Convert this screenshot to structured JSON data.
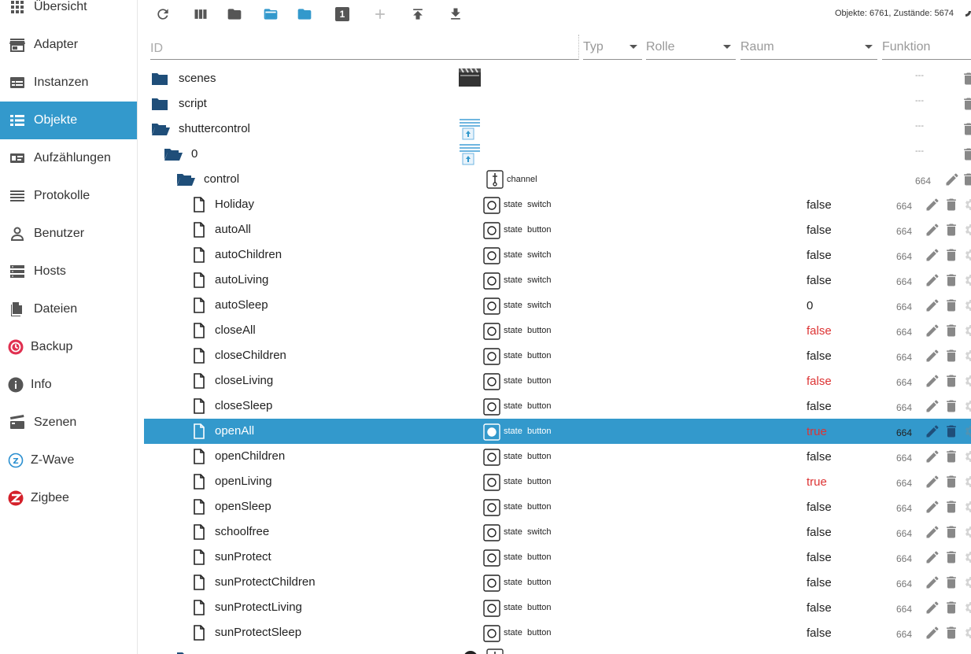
{
  "sidebar": {
    "items": [
      {
        "label": "Übersicht",
        "icon": "grid-icon"
      },
      {
        "label": "Adapter",
        "icon": "store-icon"
      },
      {
        "label": "Instanzen",
        "icon": "instances-icon"
      },
      {
        "label": "Objekte",
        "icon": "list-icon",
        "active": true
      },
      {
        "label": "Aufzählungen",
        "icon": "enum-icon"
      },
      {
        "label": "Protokolle",
        "icon": "log-icon"
      },
      {
        "label": "Benutzer",
        "icon": "user-icon"
      },
      {
        "label": "Hosts",
        "icon": "hosts-icon"
      },
      {
        "label": "Dateien",
        "icon": "files-icon"
      },
      {
        "label": "Backup",
        "icon": "backup-icon"
      },
      {
        "label": "Info",
        "icon": "info-icon"
      },
      {
        "label": "Szenen",
        "icon": "scenes-icon"
      },
      {
        "label": "Z-Wave",
        "icon": "zwave-icon"
      },
      {
        "label": "Zigbee",
        "icon": "zigbee-icon"
      }
    ]
  },
  "toolbar": {
    "stats": "Objekte: 6761, Zustände: 5674",
    "expert_badge": "1"
  },
  "filters": {
    "id_placeholder": "ID",
    "type_label": "Typ",
    "role_label": "Rolle",
    "room_label": "Raum",
    "function_label": "Funktion"
  },
  "tree": {
    "folders": [
      {
        "name": "scenes",
        "dash": "---"
      },
      {
        "name": "script",
        "dash": "---"
      },
      {
        "name": "shuttercontrol",
        "dash": "---"
      },
      {
        "name": "0",
        "dash": "---"
      },
      {
        "name": "control",
        "role": "channel",
        "acl": "664"
      }
    ],
    "states": [
      {
        "name": "Holiday",
        "role": "state  switch",
        "value": "false",
        "red": false,
        "acl": "664"
      },
      {
        "name": "autoAll",
        "role": "state  button",
        "value": "false",
        "red": false,
        "acl": "664"
      },
      {
        "name": "autoChildren",
        "role": "state  switch",
        "value": "false",
        "red": false,
        "acl": "664"
      },
      {
        "name": "autoLiving",
        "role": "state  switch",
        "value": "false",
        "red": false,
        "acl": "664"
      },
      {
        "name": "autoSleep",
        "role": "state  switch",
        "value": "0",
        "red": false,
        "acl": "664"
      },
      {
        "name": "closeAll",
        "role": "state  button",
        "value": "false",
        "red": true,
        "acl": "664"
      },
      {
        "name": "closeChildren",
        "role": "state  button",
        "value": "false",
        "red": false,
        "acl": "664"
      },
      {
        "name": "closeLiving",
        "role": "state  button",
        "value": "false",
        "red": true,
        "acl": "664"
      },
      {
        "name": "closeSleep",
        "role": "state  button",
        "value": "false",
        "red": false,
        "acl": "664"
      },
      {
        "name": "openAll",
        "role": "state  button",
        "value": "true",
        "red": true,
        "acl": "664",
        "selected": true
      },
      {
        "name": "openChildren",
        "role": "state  button",
        "value": "false",
        "red": false,
        "acl": "664"
      },
      {
        "name": "openLiving",
        "role": "state  button",
        "value": "true",
        "red": true,
        "acl": "664"
      },
      {
        "name": "openSleep",
        "role": "state  button",
        "value": "false",
        "red": false,
        "acl": "664"
      },
      {
        "name": "schoolfree",
        "role": "state  switch",
        "value": "false",
        "red": false,
        "acl": "664"
      },
      {
        "name": "sunProtect",
        "role": "state  button",
        "value": "false",
        "red": false,
        "acl": "664"
      },
      {
        "name": "sunProtectChildren",
        "role": "state  button",
        "value": "false",
        "red": false,
        "acl": "664"
      },
      {
        "name": "sunProtectLiving",
        "role": "state  button",
        "value": "false",
        "red": false,
        "acl": "664"
      },
      {
        "name": "sunProtectSleep",
        "role": "state  button",
        "value": "false",
        "red": false,
        "acl": "664"
      }
    ]
  },
  "colors": {
    "accent": "#3399cc",
    "folder": "#1f4e79",
    "value_red": "#dd3333"
  }
}
